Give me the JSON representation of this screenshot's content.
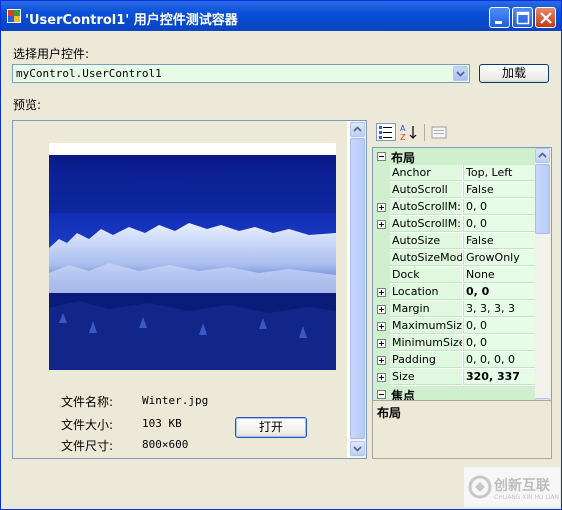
{
  "window": {
    "title": "'UserControl1' 用户控件测试容器",
    "controls": [
      "minimize",
      "maximize",
      "close"
    ]
  },
  "selector": {
    "label": "选择用户控件:",
    "value": "myControl.UserControl1",
    "load_button": "加载"
  },
  "preview": {
    "label": "预览:",
    "info": [
      {
        "label": "文件名称:",
        "value": "Winter.jpg"
      },
      {
        "label": "文件大小:",
        "value": "103 KB"
      },
      {
        "label": "文件尺寸:",
        "value": "800×600"
      }
    ],
    "open_button": "打开"
  },
  "property_grid": {
    "toolbar": [
      "categorized-icon",
      "alphabetical-icon",
      "property-pages-icon"
    ],
    "category_layout": "布局",
    "category_focus": "焦点",
    "rows": [
      {
        "name": "Anchor",
        "value": "Top, Left",
        "expandable": false,
        "bold": false
      },
      {
        "name": "AutoScroll",
        "value": "False",
        "expandable": false,
        "bold": false
      },
      {
        "name": "AutoScrollM:",
        "value": "0, 0",
        "expandable": true,
        "bold": false
      },
      {
        "name": "AutoScrollM:",
        "value": "0, 0",
        "expandable": true,
        "bold": false
      },
      {
        "name": "AutoSize",
        "value": "False",
        "expandable": false,
        "bold": false
      },
      {
        "name": "AutoSizeMode",
        "value": "GrowOnly",
        "expandable": false,
        "bold": false
      },
      {
        "name": "Dock",
        "value": "None",
        "expandable": false,
        "bold": false
      },
      {
        "name": "Location",
        "value": "0, 0",
        "expandable": true,
        "bold": true
      },
      {
        "name": "Margin",
        "value": "3, 3, 3, 3",
        "expandable": true,
        "bold": false
      },
      {
        "name": "MaximumSize",
        "value": "0, 0",
        "expandable": true,
        "bold": false
      },
      {
        "name": "MinimumSize",
        "value": "0, 0",
        "expandable": true,
        "bold": false
      },
      {
        "name": "Padding",
        "value": "0, 0, 0, 0",
        "expandable": true,
        "bold": false
      },
      {
        "name": "Size",
        "value": "320, 337",
        "expandable": true,
        "bold": true
      }
    ],
    "help_title": "布局"
  },
  "watermark": {
    "brand": "创新互联",
    "sub": "CHUANG XIN HU LIAN"
  },
  "colors": {
    "title_bar": "#0a4fd8",
    "window_bg": "#ece9d8",
    "grid_bg": "#e6fce6"
  }
}
